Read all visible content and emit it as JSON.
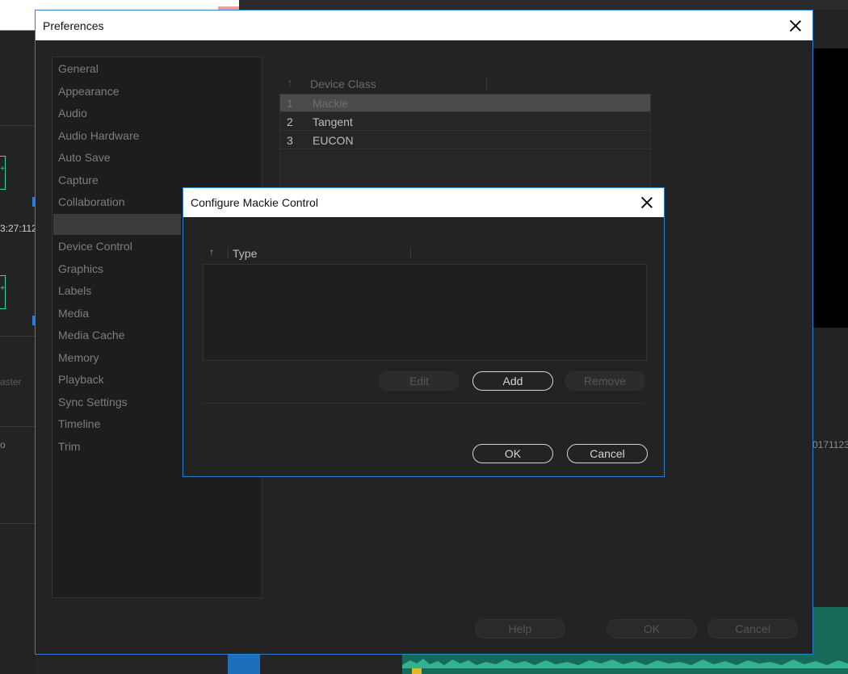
{
  "background": {
    "timecode": "3:27:112",
    "master_label": "aster",
    "info_label": "o",
    "right_timecode": "0171123."
  },
  "preferences": {
    "title": "Preferences",
    "sidebar": [
      {
        "label": "General"
      },
      {
        "label": "Appearance"
      },
      {
        "label": "Audio"
      },
      {
        "label": "Audio Hardware"
      },
      {
        "label": "Auto Save"
      },
      {
        "label": "Capture"
      },
      {
        "label": "Collaboration"
      },
      {
        "label": "",
        "selected": true
      },
      {
        "label": "Device Control"
      },
      {
        "label": "Graphics"
      },
      {
        "label": "Labels"
      },
      {
        "label": "Media"
      },
      {
        "label": "Media Cache"
      },
      {
        "label": "Memory"
      },
      {
        "label": "Playback"
      },
      {
        "label": "Sync Settings"
      },
      {
        "label": "Timeline"
      },
      {
        "label": "Trim"
      }
    ],
    "device_table": {
      "sort_icon": "↑",
      "column_header": "Device Class",
      "rows": [
        {
          "num": "1",
          "name": "Mackie",
          "selected": true
        },
        {
          "num": "2",
          "name": "Tangent"
        },
        {
          "num": "3",
          "name": "EUCON"
        }
      ]
    },
    "footer": {
      "help_label": "Help",
      "ok_label": "OK",
      "cancel_label": "Cancel"
    }
  },
  "mackie_dialog": {
    "title": "Configure Mackie Control",
    "sort_icon": "↑",
    "column_header": "Type",
    "buttons": {
      "edit_label": "Edit",
      "add_label": "Add",
      "remove_label": "Remove",
      "ok_label": "OK",
      "cancel_label": "Cancel"
    }
  },
  "colors": {
    "accent_border": "#2f7fd1",
    "clip_green": "#3fd1a6",
    "timeline_green": "#166a58",
    "marker_yellow": "#e2b928"
  }
}
